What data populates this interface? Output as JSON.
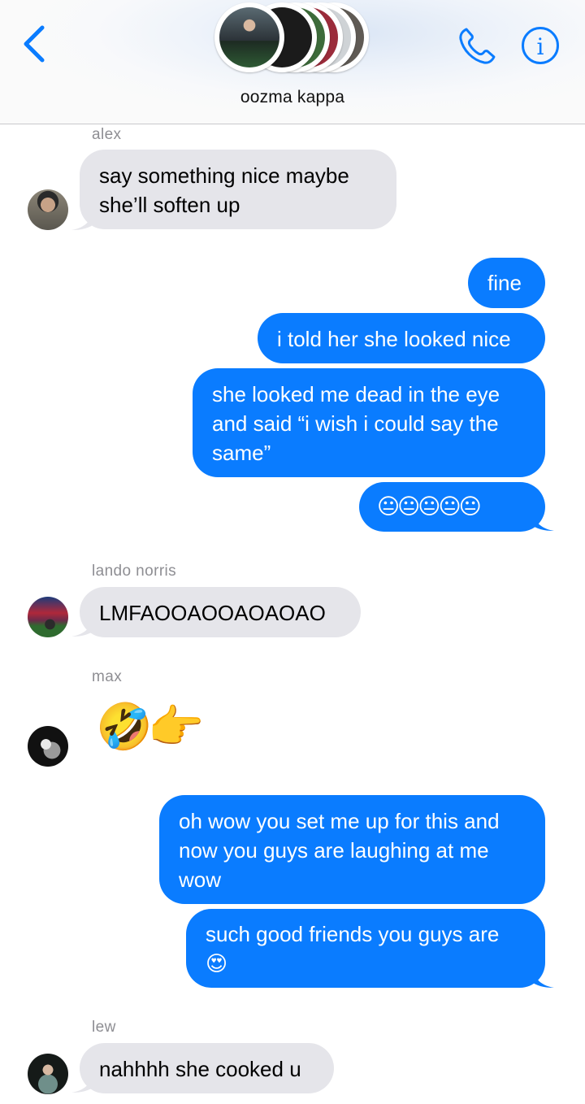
{
  "header": {
    "title": "oozma kappa",
    "icons": [
      "chevron-left-icon",
      "phone-icon",
      "info-icon"
    ],
    "accent_color": "#0a7cff"
  },
  "messages": [
    {
      "sender": "alex",
      "text_lines": [
        "say something nice  maybe",
        "she’ll soften up"
      ]
    },
    {
      "from_me": true,
      "text": "fine"
    },
    {
      "from_me": true,
      "text": "i told her she looked nice"
    },
    {
      "from_me": true,
      "text_lines": [
        "she looked me dead in the eye",
        "and said “i wish i could say the",
        "same”"
      ]
    },
    {
      "from_me": true,
      "emoji": "😐😐😐😐😐"
    },
    {
      "sender": "lando norris",
      "text": "LMFAOOAOOAOAOAO"
    },
    {
      "sender": "max",
      "emoji": "🤣👉"
    },
    {
      "from_me": true,
      "text_lines": [
        "oh wow you set me up for this and",
        "now you guys are laughing at me",
        "wow"
      ]
    },
    {
      "from_me": true,
      "text_lines": [
        "such good friends you guys are",
        "😍"
      ]
    },
    {
      "sender": "lew",
      "text": "nahhhh she cooked u"
    }
  ],
  "colors": {
    "incoming_bubble": "#e5e5ea",
    "outgoing_bubble": "#0a7cff",
    "sender_name": "#8e8e93"
  }
}
